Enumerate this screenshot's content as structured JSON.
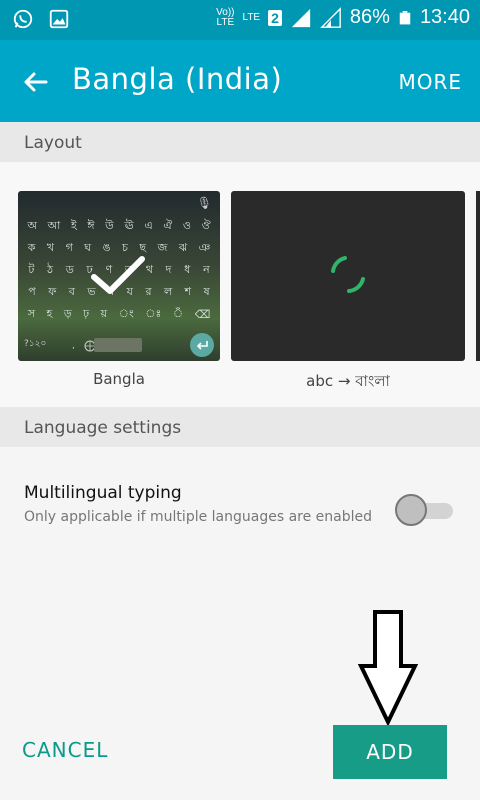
{
  "status_bar": {
    "volte_top": "Vo))",
    "volte_bottom": "LTE",
    "lte_label": "LTE",
    "sim_slot": "2",
    "battery": "86%",
    "time": "13:40",
    "icons": [
      "whatsapp-icon",
      "gallery-icon",
      "volte-icon",
      "signal-icon",
      "battery-icon"
    ]
  },
  "app_bar": {
    "title": "Bangla (India)",
    "more_label": "MORE",
    "accent": "#00a6c7"
  },
  "sections": {
    "layout_label": "Layout",
    "language_settings_label": "Language settings"
  },
  "layouts": [
    {
      "caption": "Bangla",
      "selected": true,
      "keyboard_rows": [
        [
          "অ",
          "আ",
          "ই",
          "ঈ",
          "উ",
          "ঊ",
          "এ",
          "ঐ",
          "ও",
          "ঔ"
        ],
        [
          "ক",
          "খ",
          "গ",
          "ঘ",
          "ঙ",
          "চ",
          "ছ",
          "জ",
          "ঝ",
          "ঞ"
        ],
        [
          "ট",
          "ঠ",
          "ড",
          "ঢ",
          "ণ",
          "ত",
          "থ",
          "দ",
          "ধ",
          "ন"
        ],
        [
          "প",
          "ফ",
          "ব",
          "ভ",
          "ম",
          "য",
          "র",
          "ল",
          "শ",
          "ষ"
        ],
        [
          "স",
          "হ",
          "ড়",
          "ঢ়",
          "য়",
          "ং",
          "ঃ",
          "ঁ",
          "⌫"
        ]
      ],
      "symbol_key": "?১২০",
      "comma_key": ","
    },
    {
      "caption": "abc → বাংলা",
      "selected": false,
      "loading": true
    }
  ],
  "settings": {
    "multilingual_title": "Multilingual typing",
    "multilingual_subtitle": "Only applicable if multiple languages are enabled",
    "multilingual_enabled": false
  },
  "footer": {
    "cancel_label": "CANCEL",
    "add_label": "ADD",
    "button_color": "#179c87"
  }
}
